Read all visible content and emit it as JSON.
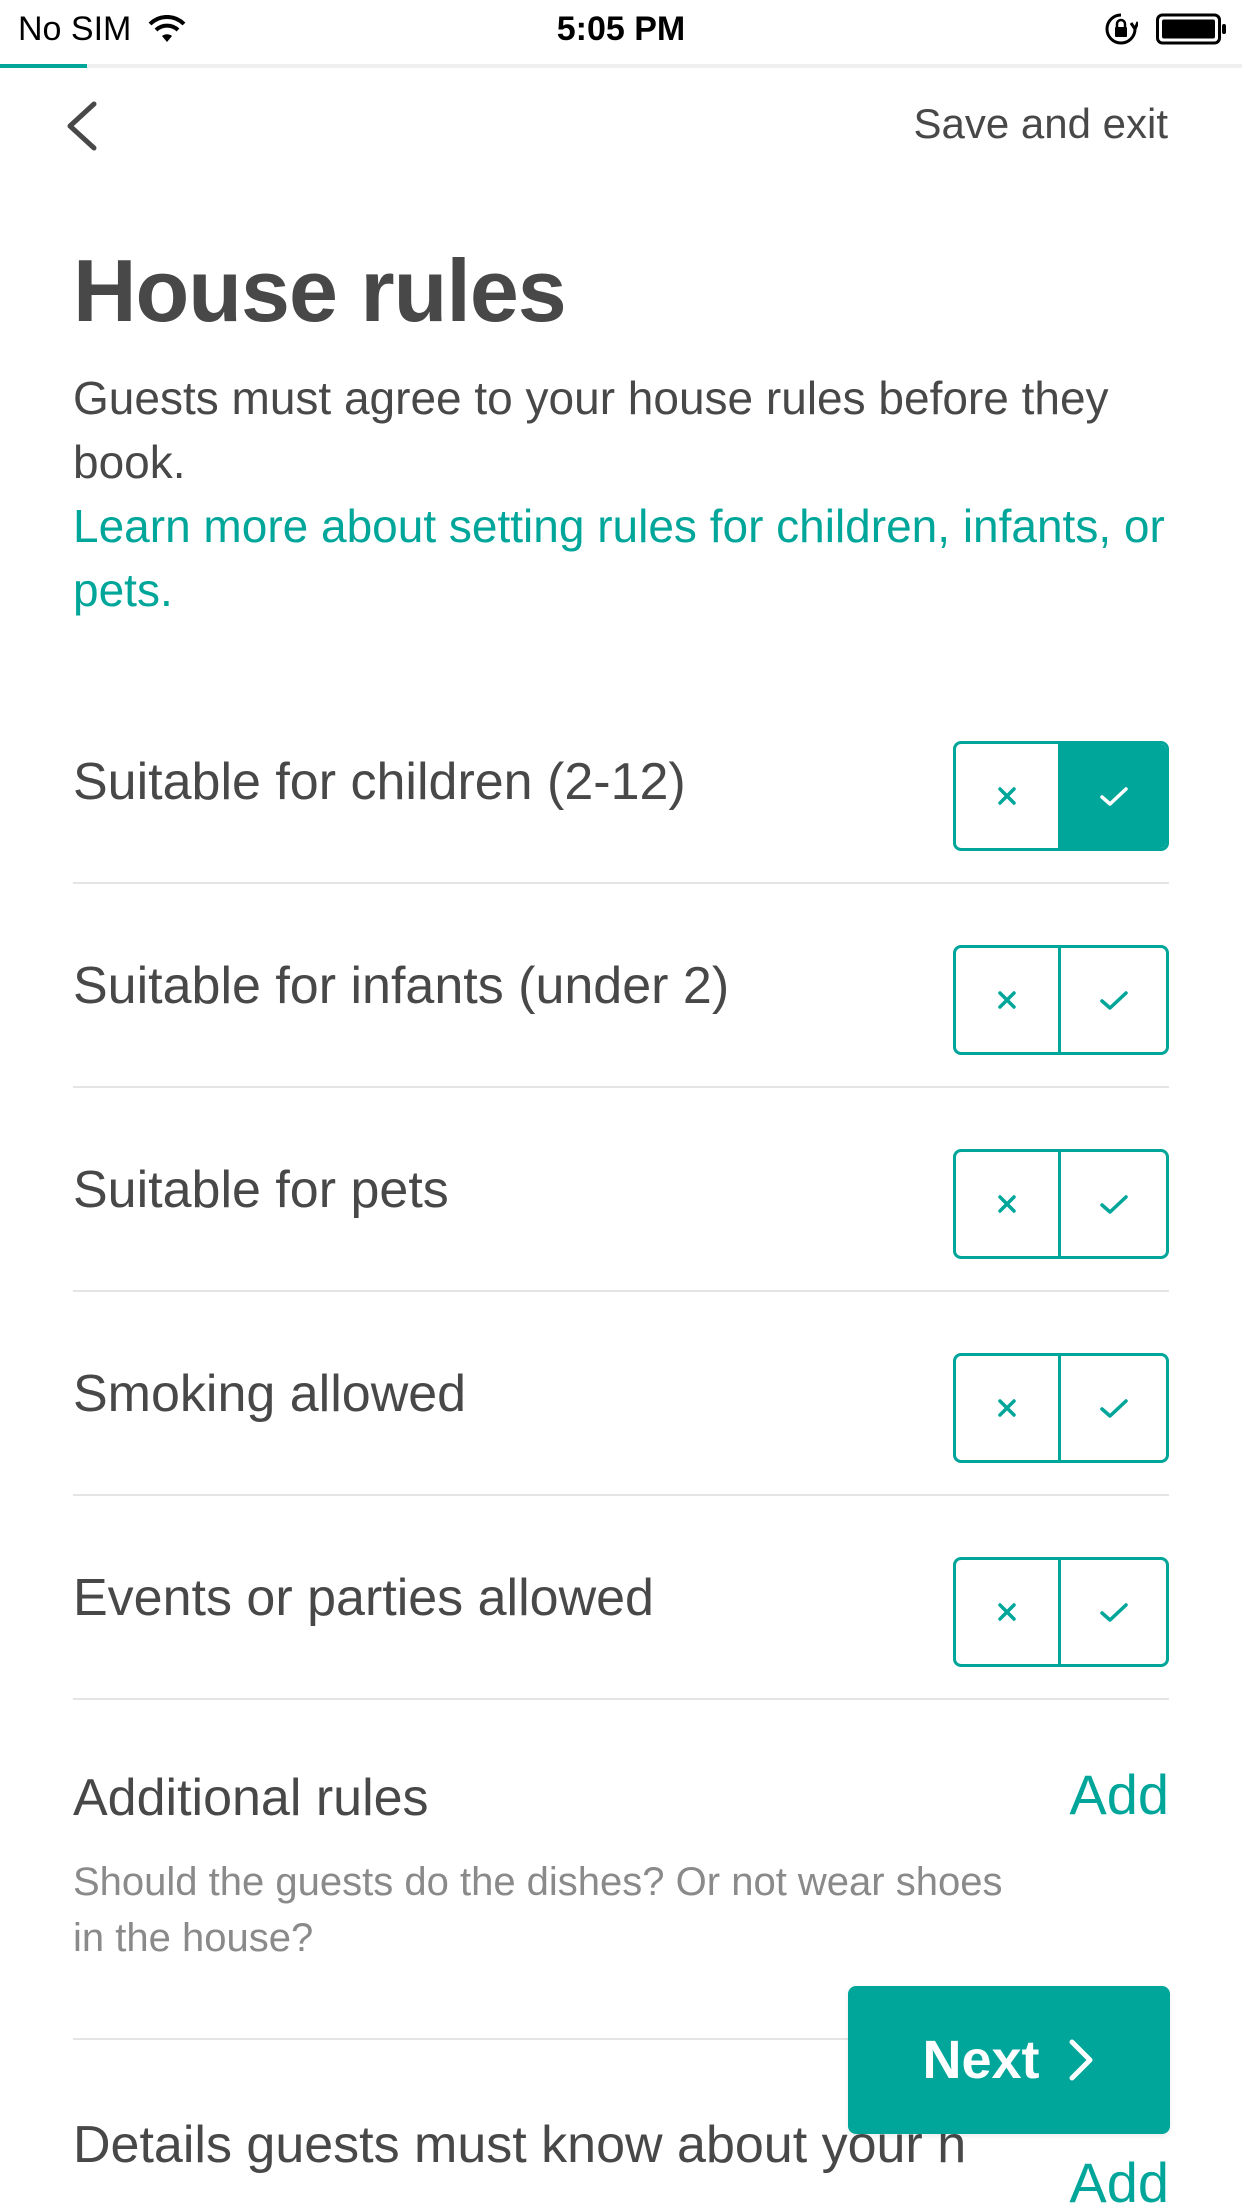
{
  "status_bar": {
    "carrier": "No SIM",
    "time": "5:05 PM",
    "icons": [
      "wifi-icon",
      "orientation-lock-icon",
      "battery-icon"
    ]
  },
  "progress": {
    "percent": 7,
    "color": "#00a699"
  },
  "nav": {
    "back_icon": "chevron-left-icon",
    "save_exit": "Save and exit"
  },
  "header": {
    "title": "House rules",
    "subtitle": "Guests must agree to your house rules before they book.",
    "learn_more": "Learn more about setting rules for children, infants, or pets."
  },
  "rules": [
    {
      "label": "Suitable for children (2-12)",
      "selected": "yes"
    },
    {
      "label": "Suitable for infants (under 2)",
      "selected": "none"
    },
    {
      "label": "Suitable for pets",
      "selected": "none"
    },
    {
      "label": "Smoking allowed",
      "selected": "none"
    },
    {
      "label": "Events or parties allowed",
      "selected": "none"
    }
  ],
  "additional_rules": {
    "title": "Additional rules",
    "add_label": "Add",
    "description": "Should the guests do the dishes? Or not wear shoes in the house?"
  },
  "details": {
    "title": "Details guests must know about your h",
    "add_label": "Add"
  },
  "next_button": {
    "label": "Next",
    "icon": "chevron-right-icon"
  },
  "colors": {
    "accent": "#00a699",
    "text": "#484848",
    "muted": "#8a8a8a",
    "divider": "#e4e4e4"
  }
}
